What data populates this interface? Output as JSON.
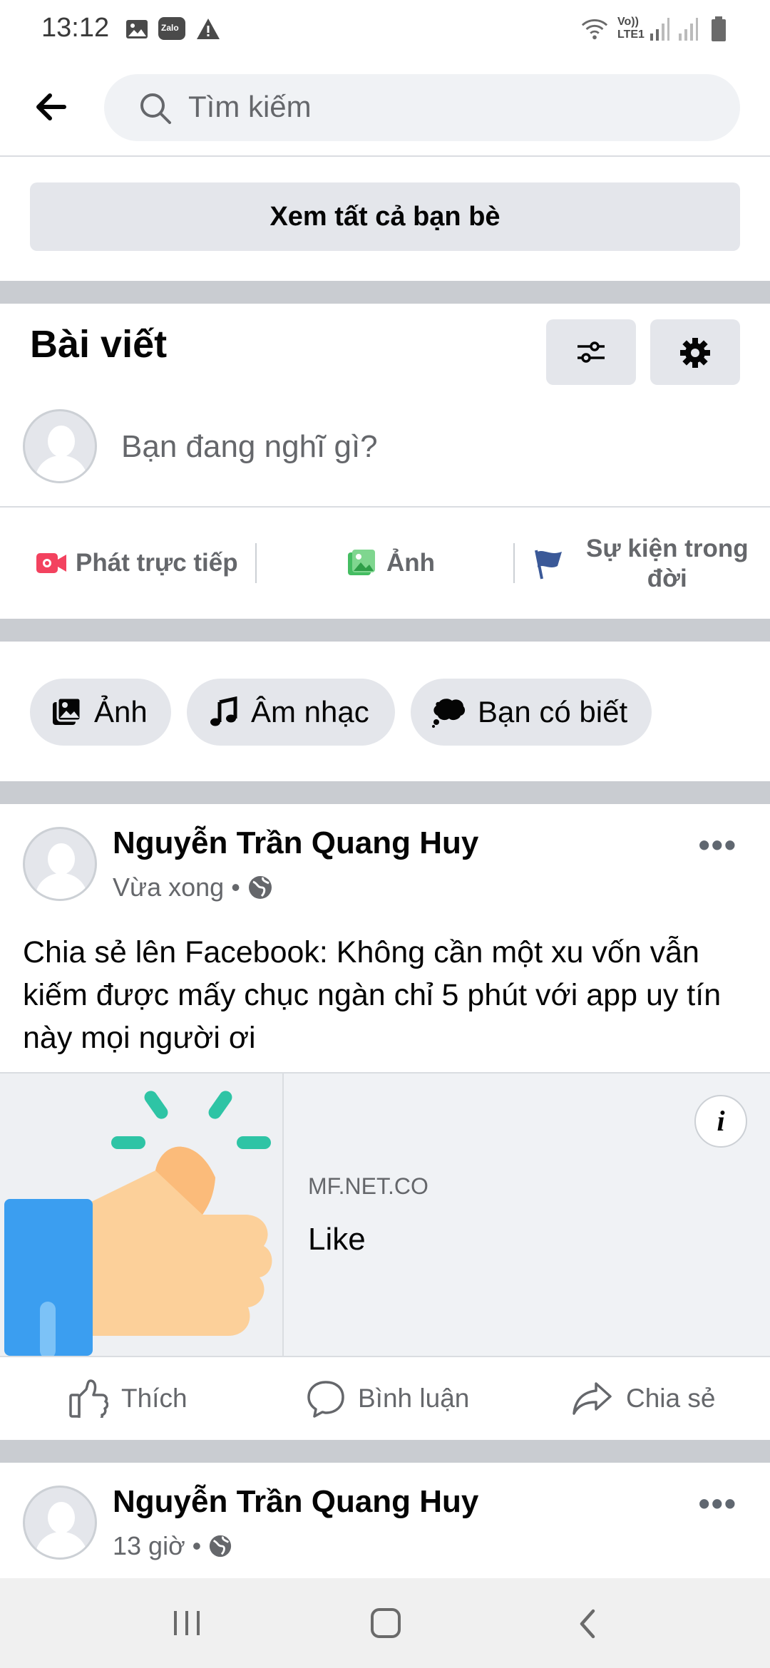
{
  "status_bar": {
    "time": "13:12",
    "network_label_top": "Vo))",
    "network_label_bottom": "LTE1",
    "icons": [
      "gallery-icon",
      "zalo-icon",
      "warning-icon",
      "wifi-icon",
      "signal-icon",
      "signal-icon",
      "battery-icon"
    ],
    "zalo_label": "Zalo"
  },
  "header": {
    "back_icon": "arrow-left-icon",
    "search_placeholder": "Tìm kiếm"
  },
  "friends": {
    "see_all_label": "Xem tất cả bạn bè"
  },
  "posts_section": {
    "title": "Bài viết",
    "filter_icon": "sliders-icon",
    "settings_icon": "gear-icon",
    "composer_placeholder": "Bạn đang nghĩ gì?",
    "actions": [
      {
        "label": "Phát trực tiếp",
        "icon": "live-video-icon",
        "color": "#f3425f"
      },
      {
        "label": "Ảnh",
        "icon": "photo-icon",
        "color": "#45bd62"
      },
      {
        "label_line1": "Sự kiện trong",
        "label_line2": "đời",
        "icon": "flag-icon",
        "color": "#3b5998"
      }
    ],
    "chips": [
      {
        "label": "Ảnh",
        "icon": "photo-icon"
      },
      {
        "label": "Âm nhạc",
        "icon": "music-note-icon"
      },
      {
        "label": "Bạn có biết",
        "icon": "speech-bubble-icon"
      }
    ]
  },
  "post1": {
    "author": "Nguyễn Trần Quang Huy",
    "time": "Vừa xong",
    "audience_icon": "globe-icon",
    "more_label": "•••",
    "text": "Chia sẻ lên Facebook: Không cần một xu vốn vẫn kiếm được mấy chục ngàn chỉ 5 phút với app uy tín này mọi người ơi",
    "link": {
      "domain": "MF.NET.CO",
      "title": "Like",
      "info_label": "i",
      "thumbnail": "thumbs-up-icon"
    },
    "actions": [
      {
        "label": "Thích",
        "icon": "thumbs-up-outline-icon"
      },
      {
        "label": "Bình luận",
        "icon": "comment-icon"
      },
      {
        "label": "Chia sẻ",
        "icon": "share-icon"
      }
    ]
  },
  "post2": {
    "author": "Nguyễn Trần Quang Huy",
    "time": "13 giờ",
    "audience_icon": "globe-icon",
    "more_label": "•••"
  },
  "nav_bar": {
    "buttons": [
      "recent-apps-icon",
      "home-icon",
      "back-icon"
    ]
  },
  "colors": {
    "separator": "#c9ccd1",
    "button_bg": "#e4e6eb",
    "secondary_text": "#65676b",
    "live_red": "#f3425f",
    "photo_green": "#45bd62",
    "flag_blue": "#3b5998"
  }
}
